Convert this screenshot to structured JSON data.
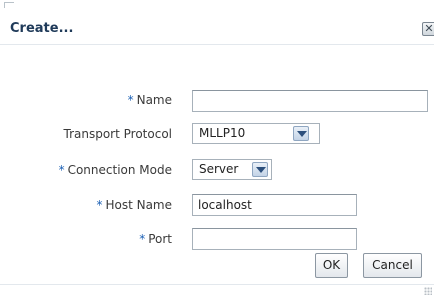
{
  "dialog": {
    "title": "Create...",
    "close_glyph": "✕"
  },
  "form": {
    "required_marker": "*",
    "name": {
      "label": "Name",
      "value": "",
      "required": true
    },
    "transport_protocol": {
      "label": "Transport Protocol",
      "value": "MLLP10",
      "required": false
    },
    "connection_mode": {
      "label": "Connection Mode",
      "value": "Server",
      "required": true
    },
    "host_name": {
      "label": "Host Name",
      "value": "localhost",
      "required": true
    },
    "port": {
      "label": "Port",
      "value": "",
      "required": true
    }
  },
  "buttons": {
    "ok": "OK",
    "cancel": "Cancel"
  },
  "colors": {
    "title": "#1f3a59",
    "required_marker": "#1a5fb4",
    "dropdown_arrow": "#2c4f7c"
  },
  "icons": {
    "close": "close-icon",
    "dropdown": "chevron-down-icon",
    "resize": "resize-grip-icon"
  }
}
